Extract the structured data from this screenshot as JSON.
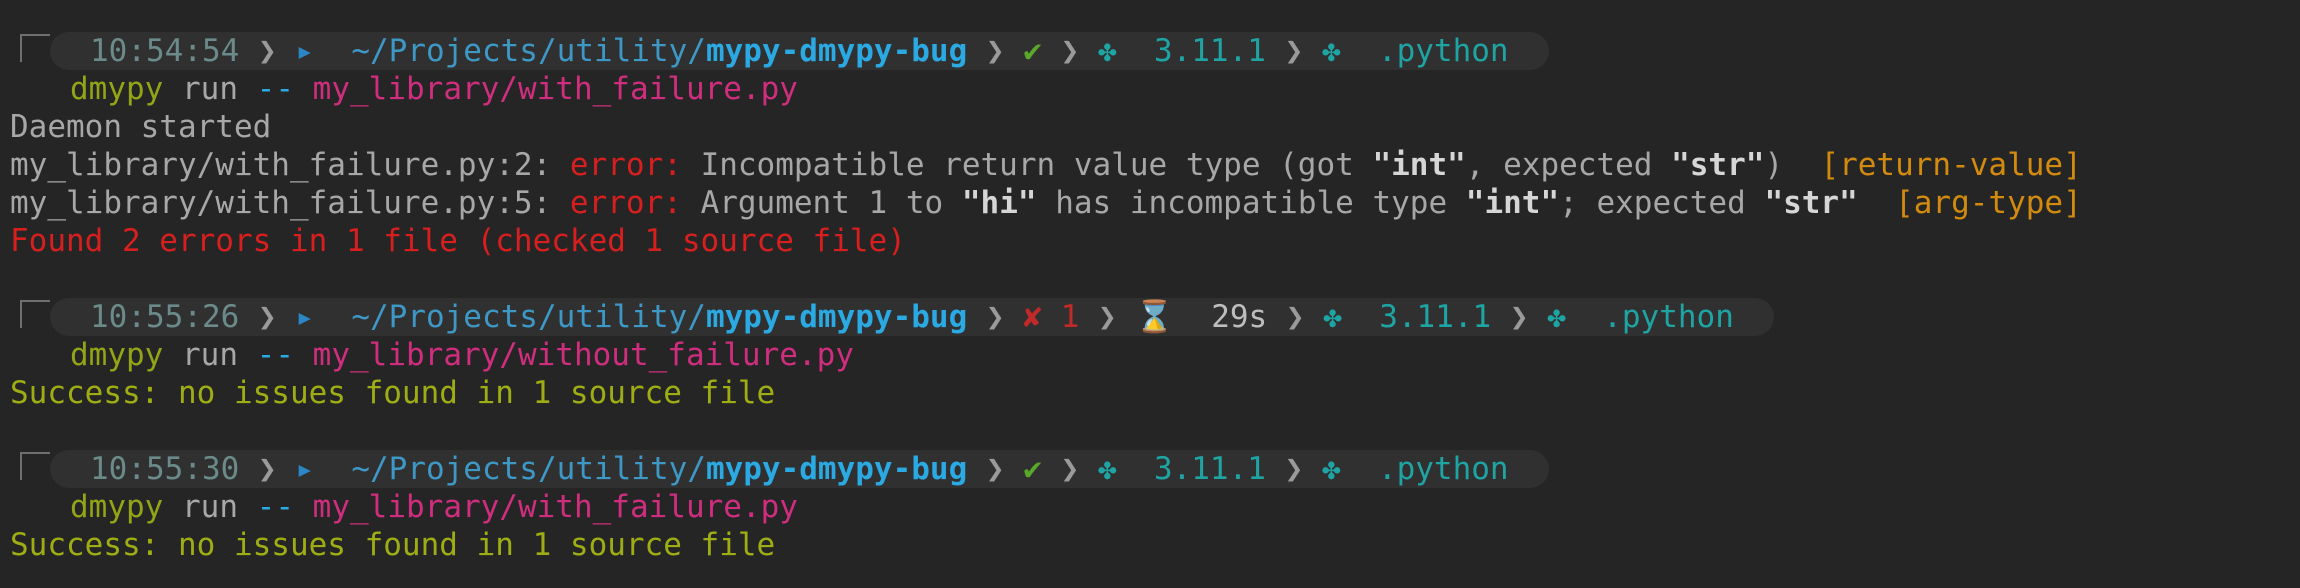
{
  "blocks": [
    {
      "prompt": {
        "time": "10:54:54",
        "path_prefix": "~/Projects/utility/",
        "path_dir": "mypy-dmypy-bug",
        "status_icon": "check-icon",
        "status_glyph": "✔",
        "python_version": "3.11.1",
        "venv": ".python"
      },
      "command": {
        "program": "dmypy",
        "arg1": "run",
        "arg2": "--",
        "file": "my_library/with_failure.py"
      }
    },
    {
      "prompt": {
        "time": "10:55:26",
        "path_prefix": "~/Projects/utility/",
        "path_dir": "mypy-dmypy-bug",
        "status_icon": "cross-icon",
        "status_glyph": "✘",
        "exit_code": "1",
        "duration_icon": "hourglass-icon",
        "duration_glyph": "⌛",
        "duration": "29s",
        "python_version": "3.11.1",
        "venv": ".python"
      },
      "command": {
        "program": "dmypy",
        "arg1": "run",
        "arg2": "--",
        "file": "my_library/without_failure.py"
      }
    },
    {
      "prompt": {
        "time": "10:55:30",
        "path_prefix": "~/Projects/utility/",
        "path_dir": "mypy-dmypy-bug",
        "status_icon": "check-icon",
        "status_glyph": "✔",
        "python_version": "3.11.1",
        "venv": ".python"
      },
      "command": {
        "program": "dmypy",
        "arg1": "run",
        "arg2": "--",
        "file": "my_library/with_failure.py"
      }
    }
  ],
  "output1": {
    "daemon": "Daemon started",
    "err1": {
      "loc": "my_library/with_failure.py:2: ",
      "label": "error:",
      "t1": " Incompatible return value type (got ",
      "q1": "\"int\"",
      "t2": ", expected ",
      "q2": "\"str\"",
      "t3": ")  ",
      "code": "[return-value]"
    },
    "err2": {
      "loc": "my_library/with_failure.py:5: ",
      "label": "error:",
      "t1": " Argument 1 to ",
      "q1": "\"hi\"",
      "t2": " has incompatible type ",
      "q2": "\"int\"",
      "t3": "; expected ",
      "q3": "\"str\"",
      "t4": "  ",
      "code": "[arg-type]"
    },
    "summary": "Found 2 errors in 1 file (checked 1 source file)"
  },
  "output2": {
    "success": "Success: no issues found in 1 source file"
  },
  "output3": {
    "success": "Success: no issues found in 1 source file"
  },
  "icons": {
    "separator": "❯",
    "folder_glyph": "▸",
    "python_glyph": "✤"
  },
  "colors": {
    "background": "#252525",
    "path": "#2aa9e3",
    "error": "#d81f1f",
    "success": "#9fad14",
    "file": "#cf2e7e",
    "tag": "#d28b0e"
  }
}
